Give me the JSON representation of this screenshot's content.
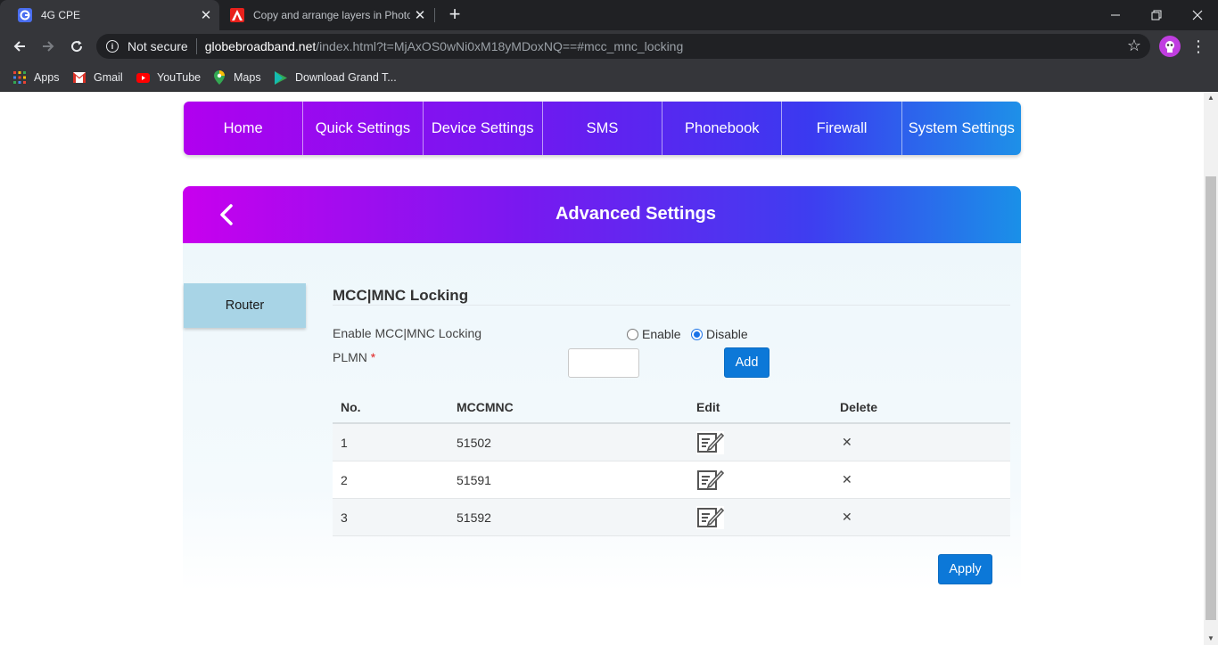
{
  "browser": {
    "tabs": [
      {
        "title": "4G CPE",
        "icon": "globe-favicon-icon"
      },
      {
        "title": "Copy and arrange layers in Photo",
        "icon": "adobe-favicon-icon"
      }
    ],
    "address": {
      "security": "Not secure",
      "host": "globebroadband.net",
      "path": "/index.html?t=MjAxOS0wNi0xM18yMDoxNQ==#mcc_mnc_locking"
    },
    "bookmarks": [
      {
        "label": "Apps",
        "icon": "apps-grid-icon"
      },
      {
        "label": "Gmail",
        "icon": "gmail-icon"
      },
      {
        "label": "YouTube",
        "icon": "youtube-icon"
      },
      {
        "label": "Maps",
        "icon": "maps-pin-icon"
      },
      {
        "label": "Download Grand T...",
        "icon": "play-store-icon"
      }
    ]
  },
  "nav": {
    "items": [
      "Home",
      "Quick Settings",
      "Device Settings",
      "SMS",
      "Phonebook",
      "Firewall",
      "System Settings"
    ]
  },
  "header": {
    "title": "Advanced Settings"
  },
  "sidebar": {
    "router": "Router"
  },
  "form": {
    "section_title": "MCC|MNC Locking",
    "enable_label": "Enable MCC|MNC Locking",
    "enable_option": "Enable",
    "disable_option": "Disable",
    "selected": "Disable",
    "plmn_label": "PLMN",
    "required_mark": "*",
    "plmn_value": "",
    "add_button": "Add",
    "apply_button": "Apply"
  },
  "table": {
    "headers": {
      "no": "No.",
      "mccmnc": "MCCMNC",
      "edit": "Edit",
      "delete": "Delete"
    },
    "rows": [
      {
        "no": "1",
        "mccmnc": "51502"
      },
      {
        "no": "2",
        "mccmnc": "51591"
      },
      {
        "no": "3",
        "mccmnc": "51592"
      }
    ]
  },
  "colors": {
    "gradient_start": "#b100ef",
    "gradient_end": "#1e90e8",
    "button_blue": "#0c78d8",
    "router_tab": "#a8d4e6"
  }
}
